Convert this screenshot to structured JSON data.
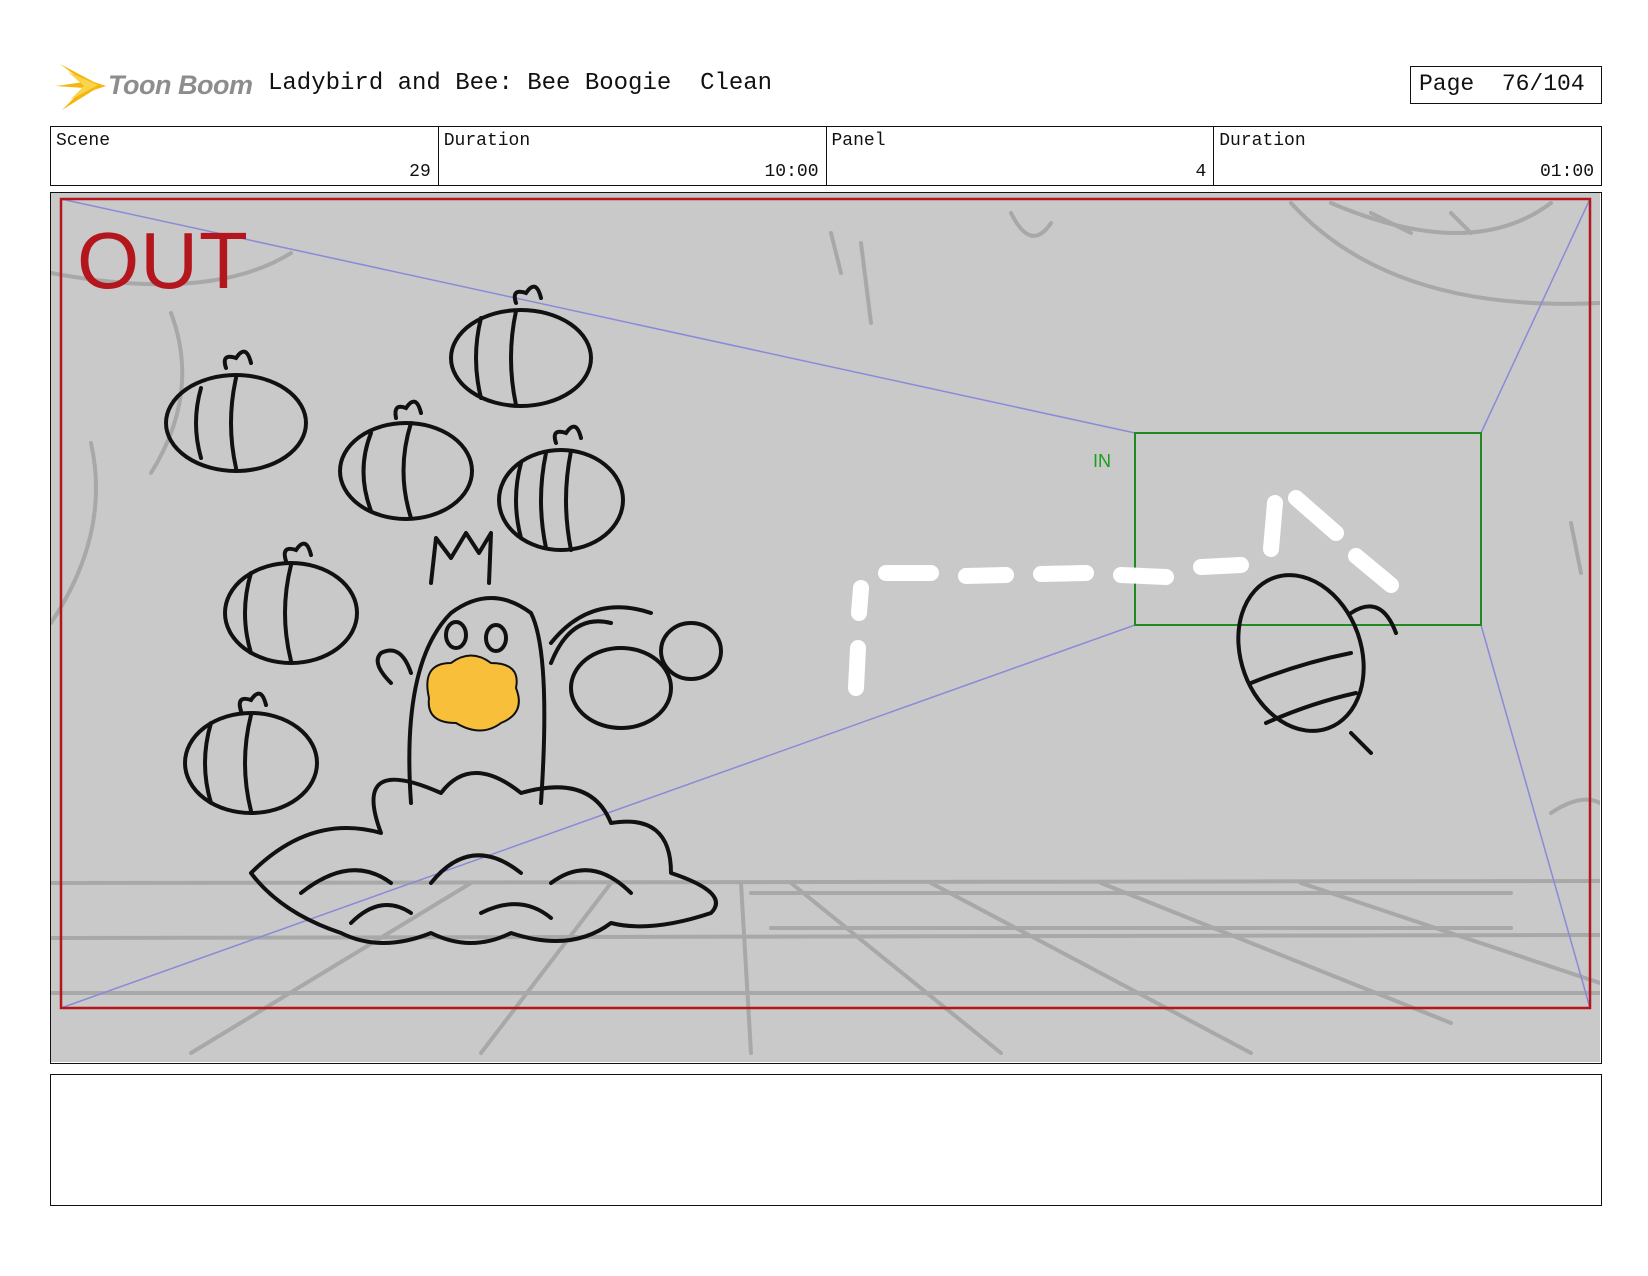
{
  "header": {
    "logo_text": "Toon Boom",
    "title": "Ladybird and Bee: Bee Boogie  Clean",
    "page": "Page  76/104"
  },
  "info": {
    "scene_label": "Scene",
    "scene_value": "29",
    "duration_label": "Duration",
    "duration_value": "10:00",
    "panel_label": "Panel",
    "panel_value": "4",
    "panel_duration_label": "Duration",
    "panel_duration_value": "01:00"
  },
  "panel": {
    "out_label": "OUT",
    "in_label": "IN",
    "out_frame_color": "#b3161c",
    "in_frame_color": "#1f8a1f",
    "guide_line_color": "#8a8ad8",
    "background_color": "#c9c9c9",
    "highlight_color": "#f7bf3a"
  },
  "notes": {
    "text": ""
  }
}
